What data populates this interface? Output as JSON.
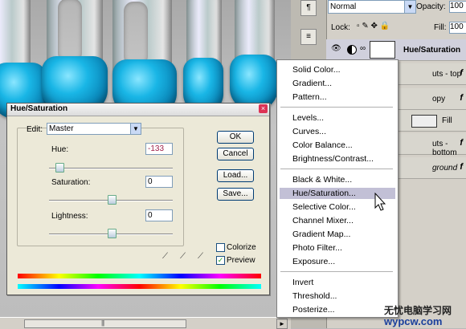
{
  "dialog": {
    "title": "Hue/Saturation",
    "close_glyph": "×",
    "edit_label": "Edit:",
    "edit_value": "Master",
    "hue_label": "Hue:",
    "hue_value": "-133",
    "saturation_label": "Saturation:",
    "saturation_value": "0",
    "lightness_label": "Lightness:",
    "lightness_value": "0",
    "ok": "OK",
    "cancel": "Cancel",
    "load": "Load...",
    "save": "Save...",
    "colorize": "Colorize",
    "preview": "Preview",
    "preview_check": "✓"
  },
  "layers_panel": {
    "blend_mode": "Normal",
    "opacity_label": "Opacity:",
    "opacity_value": "100",
    "lock_label": "Lock:",
    "fill_label": "Fill:",
    "fill_value": "100",
    "rows": [
      {
        "name": "Hue/Saturation",
        "fx": ""
      },
      {
        "name": "uts - top",
        "fx": "f"
      },
      {
        "name": "opy",
        "fx": "f"
      },
      {
        "name": "Fill",
        "fx": ""
      },
      {
        "name": "uts - bottom",
        "fx": "f"
      },
      {
        "name": "ground",
        "fx": "f"
      }
    ]
  },
  "menu": {
    "items": [
      "Solid Color...",
      "Gradient...",
      "Pattern...",
      "Levels...",
      "Curves...",
      "Color Balance...",
      "Brightness/Contrast...",
      "Black & White...",
      "Hue/Saturation...",
      "Selective Color...",
      "Channel Mixer...",
      "Gradient Map...",
      "Photo Filter...",
      "Exposure...",
      "Invert",
      "Threshold...",
      "Posterize..."
    ],
    "highlighted": "Hue/Saturation..."
  },
  "watermark": {
    "line1": "无忧电脑学习网",
    "line2": "wypcw.com"
  },
  "colors": {
    "menu_highlight": "#c2c0d6",
    "hue_value_color": "#a0204a",
    "goo_blue": "#19b6e6"
  }
}
